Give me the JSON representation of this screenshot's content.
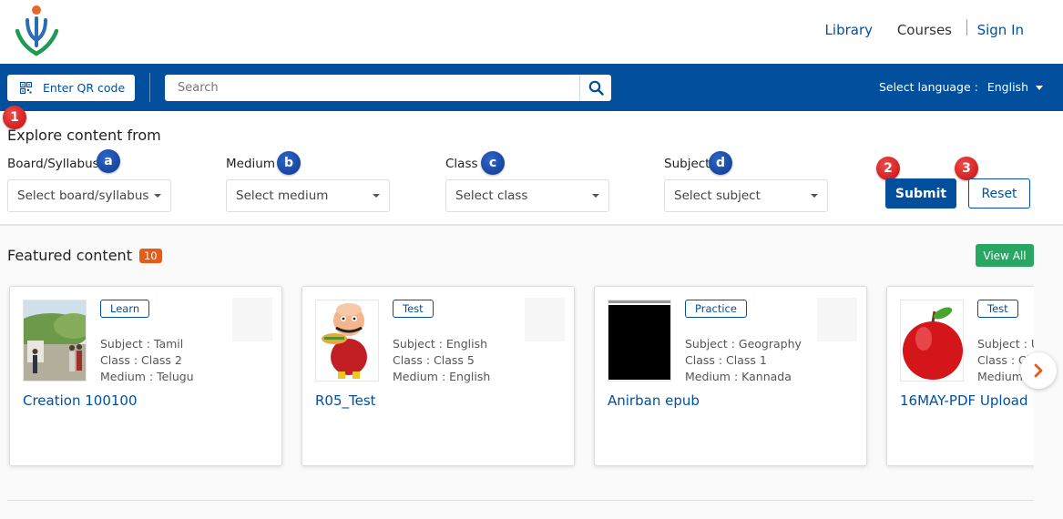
{
  "nav": {
    "library": "Library",
    "courses": "Courses",
    "sign_in": "Sign In"
  },
  "bar": {
    "qr_label": "Enter QR code",
    "search_placeholder": "Search",
    "language_label": "Select language :",
    "language_value": "English"
  },
  "annotations": {
    "one": "1",
    "two": "2",
    "three": "3",
    "a": "a",
    "b": "b",
    "c": "c",
    "d": "d"
  },
  "filters": {
    "heading": "Explore content from",
    "board": {
      "label": "Board/Syllabus",
      "placeholder": "Select board/syllabus"
    },
    "medium": {
      "label": "Medium",
      "placeholder": "Select medium"
    },
    "class": {
      "label": "Class",
      "placeholder": "Select class"
    },
    "subject": {
      "label": "Subject",
      "placeholder": "Select subject"
    },
    "submit": "Submit",
    "reset": "Reset"
  },
  "featured": {
    "title": "Featured content",
    "count": "10",
    "view_all": "View All",
    "cards": [
      {
        "tag": "Learn",
        "subject": "Subject : Tamil",
        "class": "Class : Class 2",
        "medium": "Medium : Telugu",
        "title": "Creation 100100"
      },
      {
        "tag": "Test",
        "subject": "Subject : English",
        "class": "Class : Class 5",
        "medium": "Medium : English",
        "title": "R05_Test"
      },
      {
        "tag": "Practice",
        "subject": "Subject : Geography",
        "class": "Class : Class 1",
        "medium": "Medium : Kannada",
        "title": "Anirban epub"
      },
      {
        "tag": "Test",
        "subject": "Subject : U",
        "class": "Class : Cl",
        "medium": "Medium :",
        "title": "16MAY-PDF Upload"
      }
    ]
  },
  "colors": {
    "brand_blue": "#024f9d",
    "accent_orange": "#e65c17",
    "view_all_green": "#27a762"
  }
}
